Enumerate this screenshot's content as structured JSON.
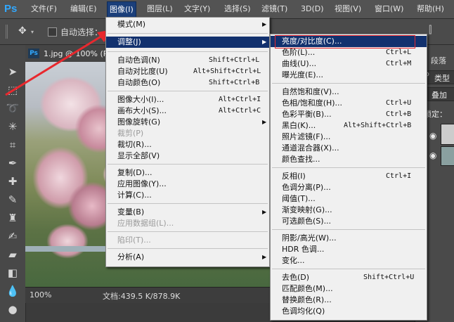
{
  "app": {
    "logo": "Ps"
  },
  "menubar": {
    "items": [
      {
        "label": "文件(F)"
      },
      {
        "label": "编辑(E)"
      },
      {
        "label": "图像(I)"
      },
      {
        "label": "图层(L)"
      },
      {
        "label": "文字(Y)"
      },
      {
        "label": "选择(S)"
      },
      {
        "label": "滤镜(T)"
      },
      {
        "label": "3D(D)"
      },
      {
        "label": "视图(V)"
      },
      {
        "label": "窗口(W)"
      },
      {
        "label": "帮助(H)"
      }
    ]
  },
  "options": {
    "auto_select": "自动选择："
  },
  "document": {
    "tab_title": "1.jpg @ 100% (RGB",
    "zoom": "100%",
    "doc_info": "文档:439.5 K/878.9K"
  },
  "right_panel": {
    "tab": "段落",
    "kind": "类型",
    "add": "叠加",
    "lock": "锁定："
  },
  "image_menu": {
    "items": [
      {
        "label": "模式(M)",
        "shortcut": ""
      },
      {
        "label": "调整(J)",
        "shortcut": ""
      },
      {
        "label": "自动色调(N)",
        "shortcut": "Shift+Ctrl+L"
      },
      {
        "label": "自动对比度(U)",
        "shortcut": "Alt+Shift+Ctrl+L"
      },
      {
        "label": "自动颜色(O)",
        "shortcut": "Shift+Ctrl+B"
      },
      {
        "label": "图像大小(I)...",
        "shortcut": "Alt+Ctrl+I"
      },
      {
        "label": "画布大小(S)...",
        "shortcut": "Alt+Ctrl+C"
      },
      {
        "label": "图像旋转(G)",
        "shortcut": ""
      },
      {
        "label": "裁剪(P)",
        "shortcut": ""
      },
      {
        "label": "裁切(R)...",
        "shortcut": ""
      },
      {
        "label": "显示全部(V)",
        "shortcut": ""
      },
      {
        "label": "复制(D)...",
        "shortcut": ""
      },
      {
        "label": "应用图像(Y)...",
        "shortcut": ""
      },
      {
        "label": "计算(C)...",
        "shortcut": ""
      },
      {
        "label": "变量(B)",
        "shortcut": ""
      },
      {
        "label": "应用数据组(L)...",
        "shortcut": ""
      },
      {
        "label": "陷印(T)...",
        "shortcut": ""
      },
      {
        "label": "分析(A)",
        "shortcut": ""
      }
    ]
  },
  "adjust_menu": {
    "items": [
      {
        "label": "亮度/对比度(C)...",
        "shortcut": ""
      },
      {
        "label": "色阶(L)...",
        "shortcut": "Ctrl+L"
      },
      {
        "label": "曲线(U)...",
        "shortcut": "Ctrl+M"
      },
      {
        "label": "曝光度(E)...",
        "shortcut": ""
      },
      {
        "label": "自然饱和度(V)...",
        "shortcut": ""
      },
      {
        "label": "色相/饱和度(H)...",
        "shortcut": "Ctrl+U"
      },
      {
        "label": "色彩平衡(B)...",
        "shortcut": "Ctrl+B"
      },
      {
        "label": "黑白(K)...",
        "shortcut": "Alt+Shift+Ctrl+B"
      },
      {
        "label": "照片滤镜(F)...",
        "shortcut": ""
      },
      {
        "label": "通道混合器(X)...",
        "shortcut": ""
      },
      {
        "label": "颜色查找...",
        "shortcut": ""
      },
      {
        "label": "反相(I)",
        "shortcut": "Ctrl+I"
      },
      {
        "label": "色调分离(P)...",
        "shortcut": ""
      },
      {
        "label": "阈值(T)...",
        "shortcut": ""
      },
      {
        "label": "渐变映射(G)...",
        "shortcut": ""
      },
      {
        "label": "可选颜色(S)...",
        "shortcut": ""
      },
      {
        "label": "阴影/高光(W)...",
        "shortcut": ""
      },
      {
        "label": "HDR 色调...",
        "shortcut": ""
      },
      {
        "label": "变化...",
        "shortcut": ""
      },
      {
        "label": "去色(D)",
        "shortcut": "Shift+Ctrl+U"
      },
      {
        "label": "匹配颜色(M)...",
        "shortcut": ""
      },
      {
        "label": "替换颜色(R)...",
        "shortcut": ""
      },
      {
        "label": "色调均化(Q)",
        "shortcut": ""
      }
    ]
  },
  "colors": {
    "highlight": "#12316e",
    "annotation": "#e8282e",
    "ps_blue": "#31a8ff"
  }
}
